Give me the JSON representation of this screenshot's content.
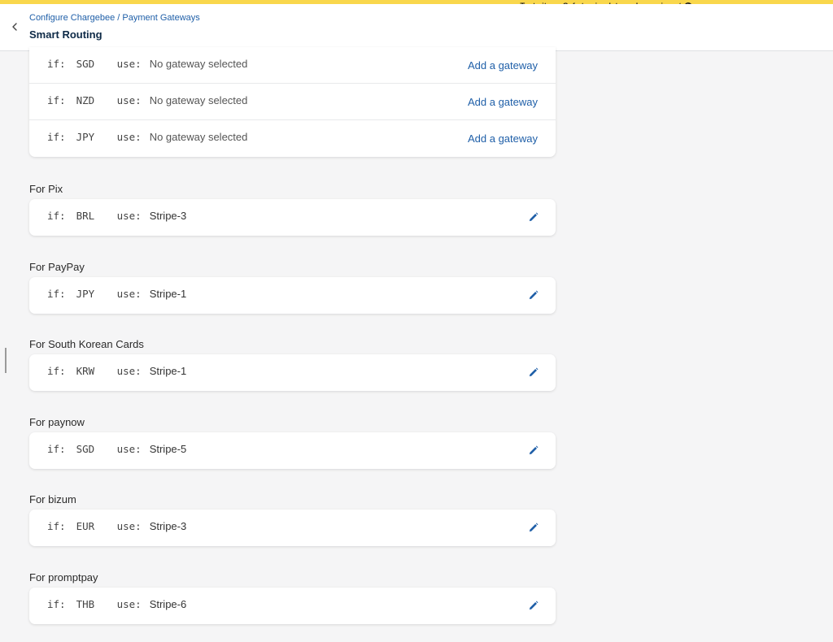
{
  "banner": {
    "text": "Test site — Safe to simulate and experiment",
    "info_glyph": "i"
  },
  "header": {
    "breadcrumb_parent": "Configure Chargebee",
    "breadcrumb_separator": "/",
    "breadcrumb_current": "Payment Gateways",
    "title": "Smart Routing"
  },
  "rules": {
    "if_label": "if:",
    "use_label": "use:",
    "no_gateway_text": "No gateway selected",
    "add_gateway_label": "Add a gateway"
  },
  "top_card": {
    "rows": [
      {
        "currency": "SGD"
      },
      {
        "currency": "NZD"
      },
      {
        "currency": "JPY"
      }
    ]
  },
  "sections": [
    {
      "label": "For Pix",
      "currency": "BRL",
      "gateway": "Stripe-3"
    },
    {
      "label": "For PayPay",
      "currency": "JPY",
      "gateway": "Stripe-1"
    },
    {
      "label": "For South Korean Cards",
      "currency": "KRW",
      "gateway": "Stripe-1"
    },
    {
      "label": "For paynow",
      "currency": "SGD",
      "gateway": "Stripe-5"
    },
    {
      "label": "For bizum",
      "currency": "EUR",
      "gateway": "Stripe-3"
    },
    {
      "label": "For promptpay",
      "currency": "THB",
      "gateway": "Stripe-6"
    }
  ],
  "colors": {
    "accent": "#1f5fa8",
    "banner": "#f9d74c",
    "title": "#0e2a47",
    "background": "#f5f5f6"
  },
  "icons": {
    "back": "chevron-left-icon",
    "info": "info-icon",
    "edit": "pencil-icon"
  }
}
